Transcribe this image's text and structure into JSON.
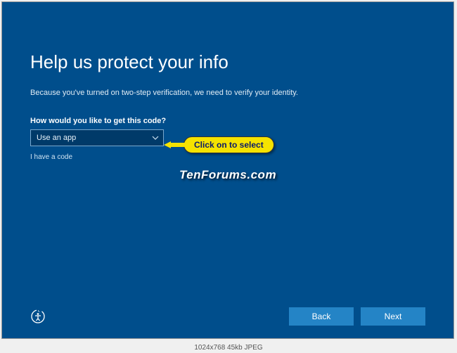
{
  "title": "Help us protect your info",
  "subtitle": "Because you've turned on two-step verification, we need to verify your identity.",
  "question": "How would you like to get this code?",
  "select": {
    "value": "Use an app"
  },
  "have_code_link": "I have a code",
  "callout": "Click on to select",
  "watermark": "TenForums.com",
  "buttons": {
    "back": "Back",
    "next": "Next"
  },
  "meta": "1024x768  45kb  JPEG"
}
